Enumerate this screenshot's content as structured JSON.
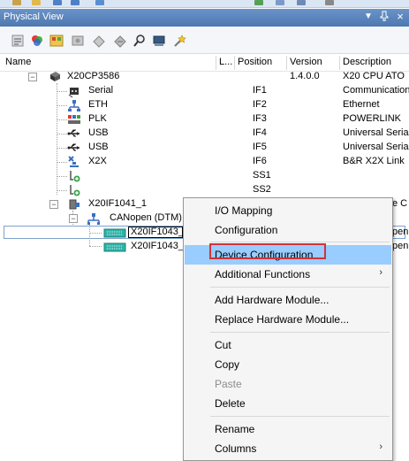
{
  "panel": {
    "title": "Physical View",
    "pin_symbol": "▼",
    "dock_symbol": "↑",
    "close_symbol": "×"
  },
  "columns": {
    "name": "Name",
    "l": "L...",
    "position": "Position",
    "version": "Version",
    "description": "Description"
  },
  "tree": [
    {
      "name": "X20CP3586",
      "position": "",
      "version": "1.4.0.0",
      "description": "X20 CPU ATO"
    },
    {
      "name": "Serial",
      "position": "IF1",
      "version": "",
      "description": "Communication"
    },
    {
      "name": "ETH",
      "position": "IF2",
      "version": "",
      "description": "Ethernet"
    },
    {
      "name": "PLK",
      "position": "IF3",
      "version": "",
      "description": "POWERLINK"
    },
    {
      "name": "USB",
      "position": "IF4",
      "version": "",
      "description": "Universal Seria"
    },
    {
      "name": "USB",
      "position": "IF5",
      "version": "",
      "description": "Universal Seria"
    },
    {
      "name": "X2X",
      "position": "IF6",
      "version": "",
      "description": "B&R X2X Link"
    },
    {
      "name": "",
      "position": "SS1",
      "version": "",
      "description": ""
    },
    {
      "name": "",
      "position": "SS2",
      "version": "",
      "description": ""
    },
    {
      "name": "X20IF1041_1",
      "position": "",
      "version": "",
      "description": "e C"
    },
    {
      "name": "CANopen (DTM)",
      "position": "",
      "version": "",
      "description": ""
    },
    {
      "name": "X20IF1043_",
      "position": "",
      "version": "",
      "description": "pen"
    },
    {
      "name": "X20IF1043_",
      "position": "",
      "version": "",
      "description": "pen"
    }
  ],
  "context_menu": {
    "items": [
      {
        "label": "I/O Mapping",
        "submenu": false,
        "enabled": true
      },
      {
        "label": "Configuration",
        "submenu": false,
        "enabled": true
      },
      {
        "label": "Device Configuration",
        "submenu": false,
        "enabled": true,
        "highlighted": true
      },
      {
        "label": "Additional Functions",
        "submenu": true,
        "enabled": true
      },
      {
        "label": "Add Hardware Module...",
        "submenu": false,
        "enabled": true
      },
      {
        "label": "Replace Hardware Module...",
        "submenu": false,
        "enabled": true
      },
      {
        "label": "Cut",
        "submenu": false,
        "enabled": true
      },
      {
        "label": "Copy",
        "submenu": false,
        "enabled": true
      },
      {
        "label": "Paste",
        "submenu": false,
        "enabled": false
      },
      {
        "label": "Delete",
        "submenu": false,
        "enabled": true
      },
      {
        "label": "Rename",
        "submenu": false,
        "enabled": true
      },
      {
        "label": "Columns",
        "submenu": true,
        "enabled": true
      }
    ],
    "submenu_arrow": "›"
  },
  "colors": {
    "highlight": "#99ccff",
    "annotation_box": "#d0333b",
    "title_bar": "#5a85bd"
  }
}
